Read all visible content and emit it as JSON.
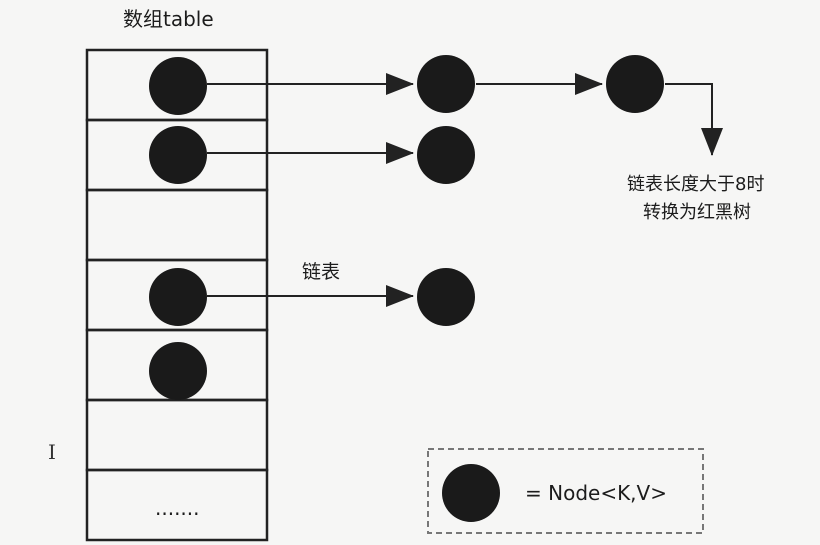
{
  "array_label": "数组table",
  "linked_list_label": "链表",
  "treeify_note": [
    "链表长度大于8时",
    "转换为红黑树"
  ],
  "ellipsis": ".......",
  "legend_text": "= Node<K,V>",
  "cursor_glyph": "I",
  "colors": {
    "background": "#f6f6f5",
    "node": "#1a1a1a",
    "line": "#222222",
    "legend_border": "#777777"
  },
  "table_rows": [
    {
      "has_node": true,
      "chain_length": 2
    },
    {
      "has_node": true,
      "chain_length": 1
    },
    {
      "has_node": false,
      "chain_length": 0
    },
    {
      "has_node": true,
      "chain_length": 1
    },
    {
      "has_node": true,
      "chain_length": 0
    },
    {
      "has_node": false,
      "chain_length": 0
    },
    {
      "has_node": false,
      "chain_length": 0,
      "ellipsis": true
    }
  ]
}
